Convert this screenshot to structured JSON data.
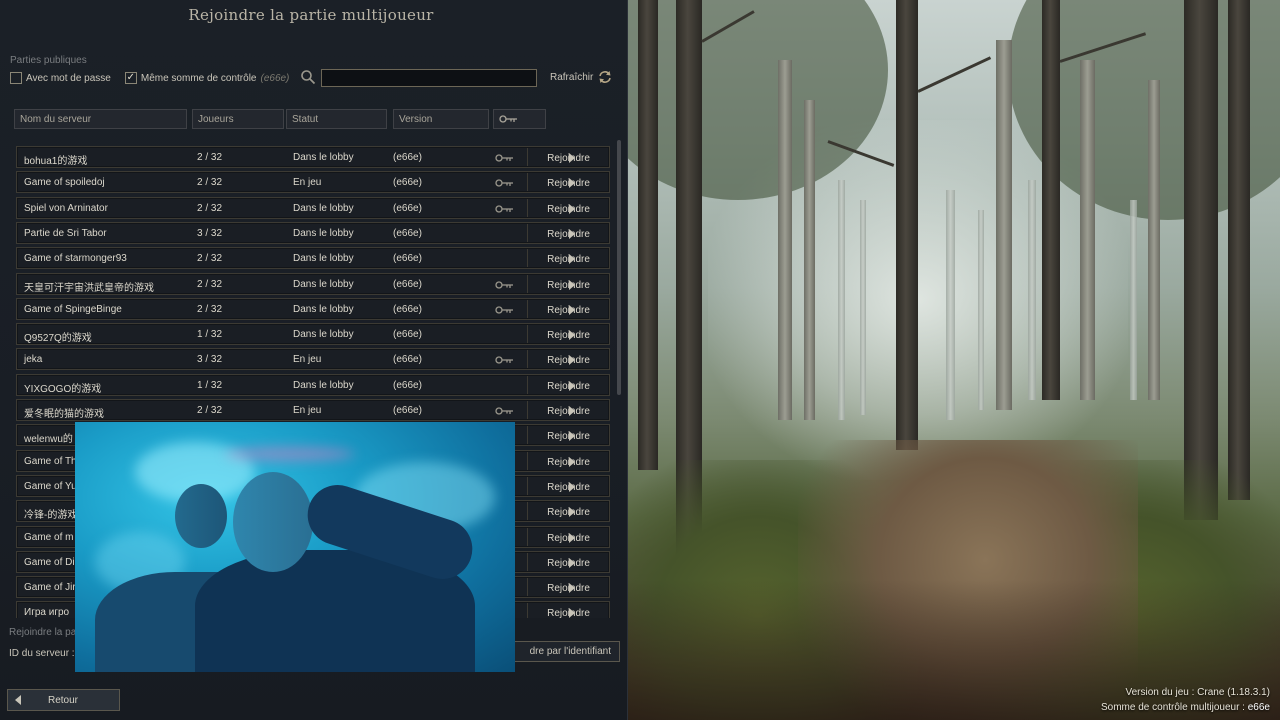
{
  "title": "Rejoindre la partie multijoueur",
  "public_games_label": "Parties publiques",
  "filters": {
    "password": {
      "label": "Avec mot de passe",
      "checked": false
    },
    "checksum": {
      "label": "Même somme de contrôle",
      "value": "(e66e)",
      "checked": true
    },
    "search_value": ""
  },
  "refresh_label": "Rafraîchir",
  "columns": [
    "Nom du serveur",
    "Joueurs",
    "Statut",
    "Version"
  ],
  "join_label": "Rejoindre",
  "servers": [
    {
      "name": "bohua1的游戏",
      "players": "2 / 32",
      "status": "Dans le lobby",
      "version": "(e66e)",
      "locked": true
    },
    {
      "name": "Game of spoiledoj",
      "players": "2 / 32",
      "status": "En jeu",
      "version": "(e66e)",
      "locked": true
    },
    {
      "name": "Spiel von Arninator",
      "players": "2 / 32",
      "status": "Dans le lobby",
      "version": "(e66e)",
      "locked": true
    },
    {
      "name": "Partie de Sri Tabor",
      "players": "3 / 32",
      "status": "Dans le lobby",
      "version": "(e66e)",
      "locked": false
    },
    {
      "name": "Game of starmonger93",
      "players": "2 / 32",
      "status": "Dans le lobby",
      "version": "(e66e)",
      "locked": false
    },
    {
      "name": "天皇可汗宇宙洪武皇帝的游戏",
      "players": "2 / 32",
      "status": "Dans le lobby",
      "version": "(e66e)",
      "locked": true
    },
    {
      "name": "Game of SpingeBinge",
      "players": "2 / 32",
      "status": "Dans le lobby",
      "version": "(e66e)",
      "locked": true
    },
    {
      "name": "Q9527Q的游戏",
      "players": "1 / 32",
      "status": "Dans le lobby",
      "version": "(e66e)",
      "locked": false
    },
    {
      "name": "jeka",
      "players": "3 / 32",
      "status": "En jeu",
      "version": "(e66e)",
      "locked": true
    },
    {
      "name": "YIXGOGO的游戏",
      "players": "1 / 32",
      "status": "Dans le lobby",
      "version": "(e66e)",
      "locked": false
    },
    {
      "name": "爱冬眠的猫的游戏",
      "players": "2 / 32",
      "status": "En jeu",
      "version": "(e66e)",
      "locked": true
    },
    {
      "name": "welenwu的",
      "players": "",
      "status": "",
      "version": "",
      "locked": false
    },
    {
      "name": "Game of Th",
      "players": "",
      "status": "",
      "version": "",
      "locked": false
    },
    {
      "name": "Game of Yu",
      "players": "",
      "status": "",
      "version": "",
      "locked": false
    },
    {
      "name": "冷锋-的游戏",
      "players": "",
      "status": "",
      "version": "",
      "locked": false
    },
    {
      "name": "Game of m",
      "players": "",
      "status": "",
      "version": "",
      "locked": false
    },
    {
      "name": "Game of Di",
      "players": "",
      "status": "",
      "version": "",
      "locked": false
    },
    {
      "name": "Game of Jir",
      "players": "",
      "status": "",
      "version": "",
      "locked": false
    },
    {
      "name": "Игра игро",
      "players": "",
      "status": "",
      "version": "",
      "locked": false
    }
  ],
  "join_by_id_label": "Rejoindre la pa",
  "server_id_label": "ID du serveur :",
  "join_by_id_button": "dre par l'identifiant",
  "back_label": "Retour",
  "game_version_line": "Version du jeu : Crane (1.18.3.1)",
  "checksum_line_prefix": "Somme de contrôle multijoueur :",
  "checksum_value": "e66e",
  "colors": {
    "panel": "#1b2027",
    "row_border": "#3c3a33",
    "text": "#dcd8cc",
    "video": "#1a9cc7"
  }
}
